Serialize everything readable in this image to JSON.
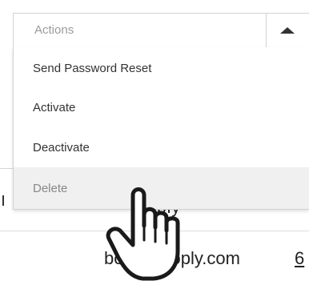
{
  "select": {
    "placeholder": "Actions",
    "toggle_icon": "caret-up-icon"
  },
  "menu": {
    "items": [
      {
        "label": "Send Password Reset"
      },
      {
        "label": "Activate"
      },
      {
        "label": "Deactivate"
      },
      {
        "label": "Delete",
        "hovered": true
      }
    ]
  },
  "background": {
    "email": "bob@hooply.com",
    "under_text": "ply",
    "right_char": "6"
  },
  "cursor": {
    "icon": "hand-pointer-icon"
  }
}
